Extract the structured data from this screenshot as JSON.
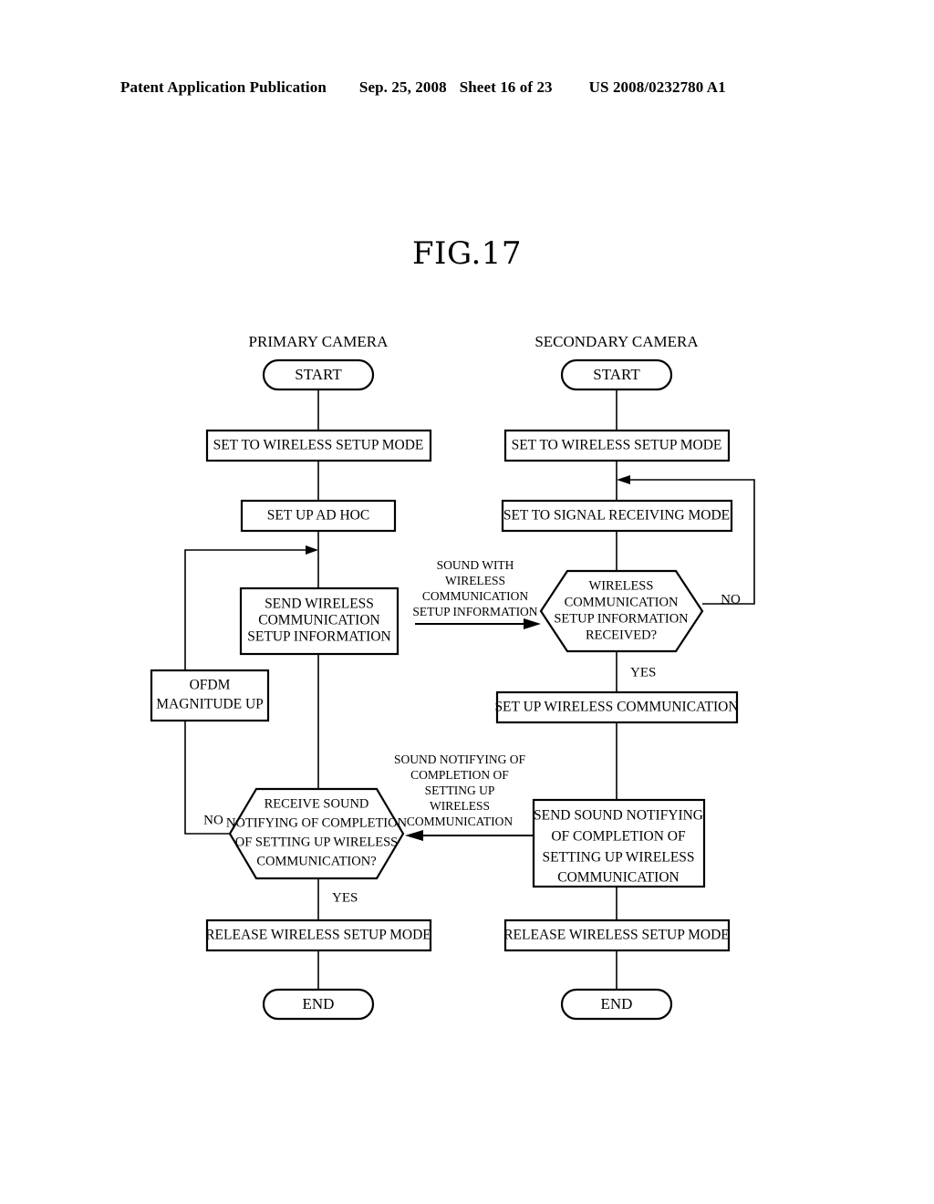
{
  "header": {
    "publication": "Patent Application Publication",
    "date": "Sep. 25, 2008",
    "sheet": "Sheet 16 of 23",
    "patent_number": "US 2008/0232780 A1"
  },
  "figure": {
    "title": "FIG.17"
  },
  "lanes": [
    {
      "id": "primary",
      "title": "PRIMARY CAMERA"
    },
    {
      "id": "secondary",
      "title": "SECONDARY CAMERA"
    }
  ],
  "primary": {
    "start": "START",
    "step_setup_mode": "SET TO WIRELESS SETUP MODE",
    "step_ad_hoc": "SET UP AD HOC",
    "step_send_info_l1": "SEND WIRELESS",
    "step_send_info_l2": "COMMUNICATION",
    "step_send_info_l3": "SETUP INFORMATION",
    "step_ofdm_l1": "OFDM",
    "step_ofdm_l2": "MAGNITUDE UP",
    "decision_receive_l1": "RECEIVE SOUND",
    "decision_receive_l2": "NOTIFYING OF COMPLETION",
    "decision_receive_l3": "OF SETTING UP WIRELESS",
    "decision_receive_l4": "COMMUNICATION?",
    "decision_receive_no": "NO",
    "decision_receive_yes": "YES",
    "step_release": "RELEASE WIRELESS SETUP MODE",
    "end": "END"
  },
  "secondary": {
    "start": "START",
    "step_setup_mode": "SET TO WIRELESS SETUP MODE",
    "step_signal_receiving": "SET TO SIGNAL RECEIVING MODE",
    "decision_info_received_l1": "WIRELESS",
    "decision_info_received_l2": "COMMUNICATION",
    "decision_info_received_l3": "SETUP INFORMATION",
    "decision_info_received_l4": "RECEIVED?",
    "decision_info_received_no": "NO",
    "decision_info_received_yes": "YES",
    "step_setup_comm": "SET UP WIRELESS COMMUNICATION",
    "step_send_sound_l1": "SEND SOUND NOTIFYING",
    "step_send_sound_l2": "OF COMPLETION OF",
    "step_send_sound_l3": "SETTING UP WIRELESS",
    "step_send_sound_l4": "COMMUNICATION",
    "step_release": "RELEASE WIRELESS SETUP MODE",
    "end": "END"
  },
  "edge_labels": {
    "sound_with_setup_info": {
      "l1": "SOUND WITH",
      "l2": "WIRELESS",
      "l3": "COMMUNICATION",
      "l4": "SETUP INFORMATION"
    },
    "sound_notifying_completion": {
      "l1": "SOUND NOTIFYING OF",
      "l2": "COMPLETION OF",
      "l3": "SETTING UP",
      "l4": "WIRELESS",
      "l5": "COMMUNICATION"
    }
  },
  "colors": {
    "ink": "#000000",
    "paper": "#ffffff"
  }
}
